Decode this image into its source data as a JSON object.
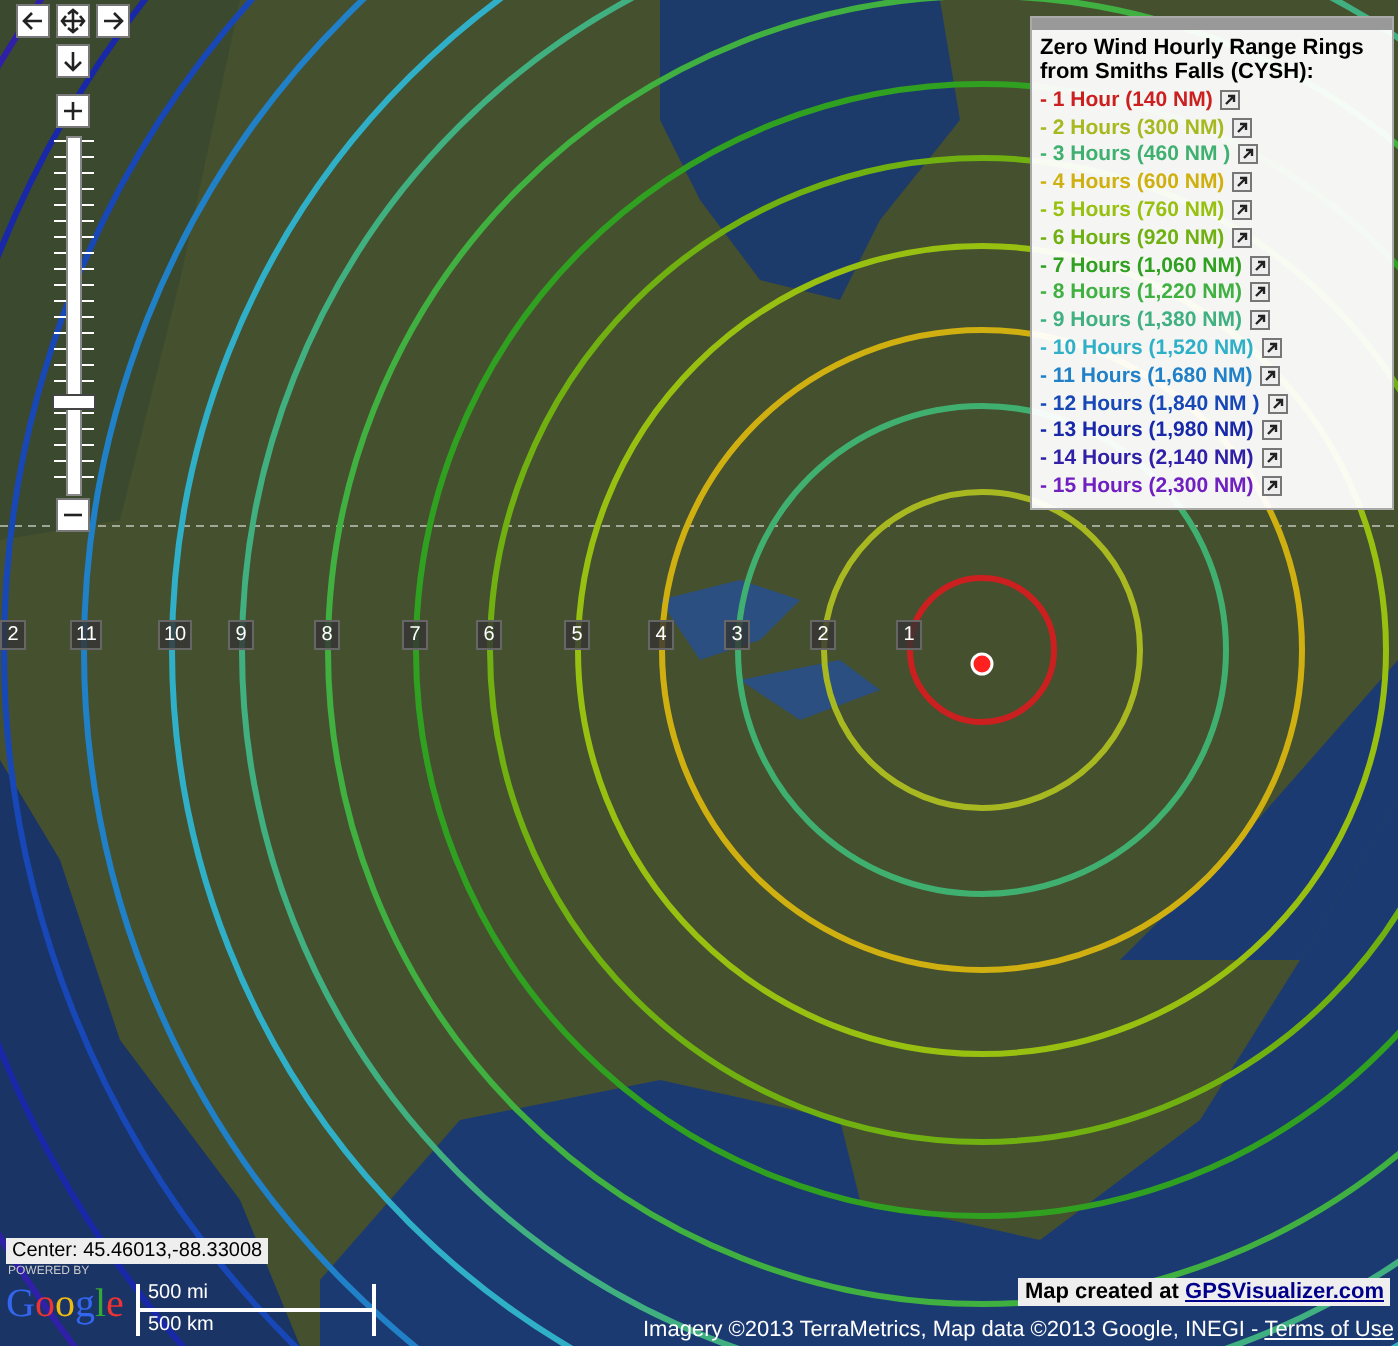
{
  "legend": {
    "title": "Zero Wind Hourly Range Rings from Smiths Falls (CYSH):",
    "items": [
      {
        "label": "- 1 Hour (140 NM)",
        "color": "#cc2020"
      },
      {
        "label": "- 2 Hours (300 NM)",
        "color": "#a8b820"
      },
      {
        "label": "- 3 Hours (460 NM )",
        "color": "#40b070"
      },
      {
        "label": "- 4 Hours (600 NM)",
        "color": "#d0b010"
      },
      {
        "label": "- 5 Hours (760 NM)",
        "color": "#98c010"
      },
      {
        "label": "- 6 Hours (920 NM)",
        "color": "#70b010"
      },
      {
        "label": "- 7 Hours (1,060 NM)",
        "color": "#30a020"
      },
      {
        "label": "- 8 Hours (1,220 NM)",
        "color": "#40b040"
      },
      {
        "label": "- 9 Hours (1,380 NM)",
        "color": "#40b080"
      },
      {
        "label": "- 10 Hours (1,520 NM)",
        "color": "#30b0c8"
      },
      {
        "label": "- 11 Hours (1,680 NM)",
        "color": "#2080c8"
      },
      {
        "label": "- 12 Hours (1,840 NM )",
        "color": "#1848b8"
      },
      {
        "label": "- 13 Hours (1,980 NM)",
        "color": "#1828a8"
      },
      {
        "label": "- 14 Hours (2,140 NM)",
        "color": "#3020a8"
      },
      {
        "label": "- 15 Hours (2,300 NM)",
        "color": "#7020c0"
      }
    ]
  },
  "ring_labels": [
    "2",
    "11",
    "10",
    "9",
    "8",
    "7",
    "6",
    "5",
    "4",
    "3",
    "2",
    "1"
  ],
  "zoom_slider": {
    "level": 0.25
  },
  "center_readout": "Center: 45.46013,-88.33008",
  "scale": {
    "miles": "500 mi",
    "km": "500 km"
  },
  "powered_by": "POWERED BY",
  "logo": "Google",
  "attribution": "Imagery ©2013 TerraMetrics, Map data ©2013 Google, INEGI - ",
  "terms_link": "Terms of Use",
  "credit": {
    "text": "Map created at ",
    "link": "GPSVisualizer.com"
  }
}
